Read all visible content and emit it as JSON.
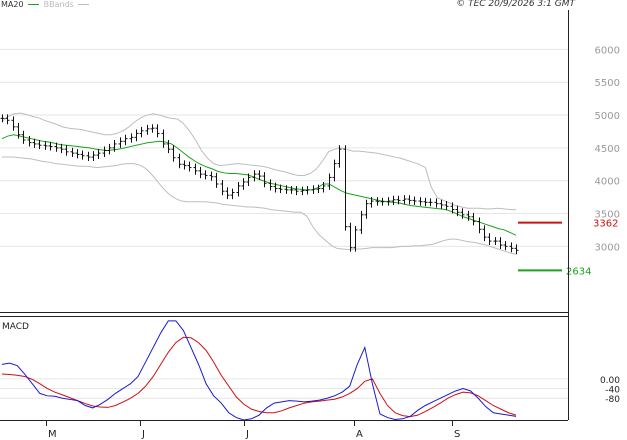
{
  "header": {
    "credit": "© TEC 20/9/2026 3:1 GMT",
    "legend": [
      {
        "label": "MA20",
        "color": "#1aa31a"
      },
      {
        "label": "BBands",
        "color": "#bdbdbd"
      }
    ]
  },
  "macd_label": "MACD",
  "colors": {
    "price": "#111111",
    "ma20": "#1aa31a",
    "bbands": "#bdbdbd",
    "macd": "#1a1acd",
    "signal": "#cc1111",
    "resistance": "#cc1111",
    "support": "#1aa31a",
    "grid": "#e6e6e6"
  },
  "chart_data": [
    {
      "type": "line",
      "panel": "price",
      "ylim": [
        2000,
        6600
      ],
      "yticks": [
        "6000",
        "5500",
        "5000",
        "4500",
        "4000",
        "3500",
        "3000"
      ],
      "x_labels": [
        "M",
        "J",
        "J",
        "A",
        "S"
      ],
      "series": [
        {
          "name": "MA20",
          "values": [
            4640,
            4680,
            4700,
            4680,
            4660,
            4640,
            4620,
            4600,
            4590,
            4570,
            4550,
            4540,
            4530,
            4520,
            4510,
            4500,
            4480,
            4470,
            4460,
            4470,
            4480,
            4500,
            4520,
            4540,
            4560,
            4580,
            4590,
            4600,
            4590,
            4560,
            4500,
            4430,
            4360,
            4300,
            4250,
            4210,
            4180,
            4140,
            4120,
            4110,
            4110,
            4100,
            4090,
            4060,
            4020,
            3990,
            3960,
            3940,
            3920,
            3900,
            3880,
            3870,
            3860,
            3860,
            3890,
            3950,
            3950,
            3900,
            3850,
            3810,
            3790,
            3770,
            3750,
            3730,
            3710,
            3690,
            3680,
            3670,
            3660,
            3640,
            3620,
            3610,
            3600,
            3590,
            3580,
            3570,
            3560,
            3530,
            3490,
            3450,
            3420,
            3390,
            3360,
            3330,
            3300,
            3270,
            3250,
            3210,
            3170
          ]
        },
        {
          "name": "BBands",
          "values": [
            4900,
            4980,
            5020,
            5030,
            5010,
            4980,
            4960,
            4920,
            4890,
            4860,
            4820,
            4800,
            4790,
            4780,
            4760,
            4740,
            4720,
            4700,
            4700,
            4720,
            4760,
            4820,
            4900,
            4960,
            5000,
            5020,
            5000,
            4970,
            4950,
            4940,
            4870,
            4760,
            4620,
            4460,
            4340,
            4260,
            4230,
            4240,
            4250,
            4260,
            4250,
            4240,
            4230,
            4220,
            4200,
            4170,
            4150,
            4130,
            4100,
            4080,
            4080,
            4110,
            4180,
            4300,
            4440,
            4480,
            4500,
            4480,
            4450,
            4450,
            4440,
            4430,
            4420,
            4400,
            4380,
            4360,
            4340,
            4310,
            4280,
            4250,
            4200,
            3900,
            3740,
            3700,
            3660,
            3620,
            3600,
            3580,
            3580,
            3580,
            3570,
            3570,
            3580,
            3570,
            3560,
            3560
          ]
        },
        {
          "name": "BBands",
          "values": [
            4360,
            4360,
            4360,
            4350,
            4340,
            4330,
            4310,
            4290,
            4280,
            4260,
            4250,
            4240,
            4230,
            4220,
            4220,
            4210,
            4200,
            4210,
            4220,
            4230,
            4250,
            4260,
            4260,
            4240,
            4190,
            4100,
            3990,
            3880,
            3790,
            3730,
            3690,
            3680,
            3680,
            3680,
            3680,
            3670,
            3660,
            3640,
            3630,
            3620,
            3610,
            3600,
            3600,
            3590,
            3580,
            3560,
            3550,
            3540,
            3530,
            3520,
            3520,
            3460,
            3300,
            3180,
            3100,
            3020,
            2970,
            2960,
            2950,
            2960,
            2960,
            2970,
            2980,
            2980,
            2980,
            2980,
            2990,
            3000,
            3000,
            3010,
            3010,
            3020,
            3030,
            3060,
            3090,
            3110,
            3110,
            3090,
            3070,
            3060,
            3040,
            3020,
            2990,
            2960,
            2930,
            2900,
            2880
          ]
        },
        {
          "name": "Price",
          "values": [
            4950,
            4920,
            4820,
            4700,
            4620,
            4580,
            4560,
            4540,
            4530,
            4520,
            4500,
            4480,
            4440,
            4420,
            4400,
            4380,
            4360,
            4390,
            4420,
            4460,
            4500,
            4560,
            4600,
            4640,
            4660,
            4720,
            4760,
            4790,
            4800,
            4720,
            4560,
            4480,
            4350,
            4250,
            4230,
            4200,
            4150,
            4100,
            4080,
            4060,
            3950,
            3840,
            3780,
            3820,
            3920,
            3980,
            4050,
            4100,
            4070,
            3960,
            3910,
            3880,
            3870,
            3860,
            3860,
            3840,
            3850,
            3860,
            3870,
            3880,
            3920,
            4050,
            4260,
            4480,
            3300,
            2980,
            3250,
            3480,
            3650,
            3690,
            3680,
            3680,
            3690,
            3710,
            3700,
            3720,
            3700,
            3690,
            3680,
            3670,
            3670,
            3650,
            3630,
            3610,
            3560,
            3520,
            3480,
            3450,
            3380,
            3260,
            3140,
            3080,
            3080,
            3020,
            3000,
            2970,
            2940
          ]
        },
        {
          "name": "Resistance",
          "values": [
            3362
          ]
        },
        {
          "name": "Support",
          "values": [
            2634
          ]
        }
      ],
      "data_labels": [
        "3362",
        "2634"
      ]
    },
    {
      "type": "line",
      "panel": "macd",
      "ylim": [
        -170,
        260
      ],
      "yticks": [
        "0.00",
        "-40",
        "-80"
      ],
      "series": [
        {
          "name": "MACD",
          "values": [
            60,
            65,
            55,
            20,
            -20,
            -60,
            -70,
            -72,
            -80,
            -85,
            -90,
            -110,
            -120,
            -105,
            -85,
            -60,
            -40,
            -20,
            10,
            70,
            130,
            190,
            240,
            240,
            200,
            130,
            60,
            -20,
            -70,
            -100,
            -140,
            -160,
            -170,
            -165,
            -150,
            -120,
            -100,
            -95,
            -90,
            -92,
            -95,
            -92,
            -88,
            -80,
            -70,
            -55,
            -30,
            60,
            130,
            -20,
            -145,
            -160,
            -168,
            -165,
            -155,
            -130,
            -110,
            -95,
            -80,
            -65,
            -50,
            -40,
            -50,
            -80,
            -115,
            -140,
            -145,
            -150,
            -155
          ]
        },
        {
          "name": "Signal",
          "values": [
            20,
            18,
            15,
            10,
            -2,
            -20,
            -40,
            -55,
            -66,
            -78,
            -90,
            -102,
            -112,
            -116,
            -118,
            -110,
            -96,
            -80,
            -60,
            -30,
            10,
            60,
            110,
            150,
            172,
            170,
            150,
            118,
            70,
            15,
            -30,
            -75,
            -105,
            -125,
            -135,
            -140,
            -140,
            -132,
            -120,
            -110,
            -100,
            -95,
            -92,
            -88,
            -84,
            -75,
            -60,
            -40,
            -10,
            0,
            -60,
            -110,
            -140,
            -152,
            -156,
            -150,
            -135,
            -118,
            -100,
            -80,
            -65,
            -55,
            -58,
            -70,
            -90,
            -110,
            -125,
            -140,
            -150
          ]
        }
      ]
    }
  ]
}
